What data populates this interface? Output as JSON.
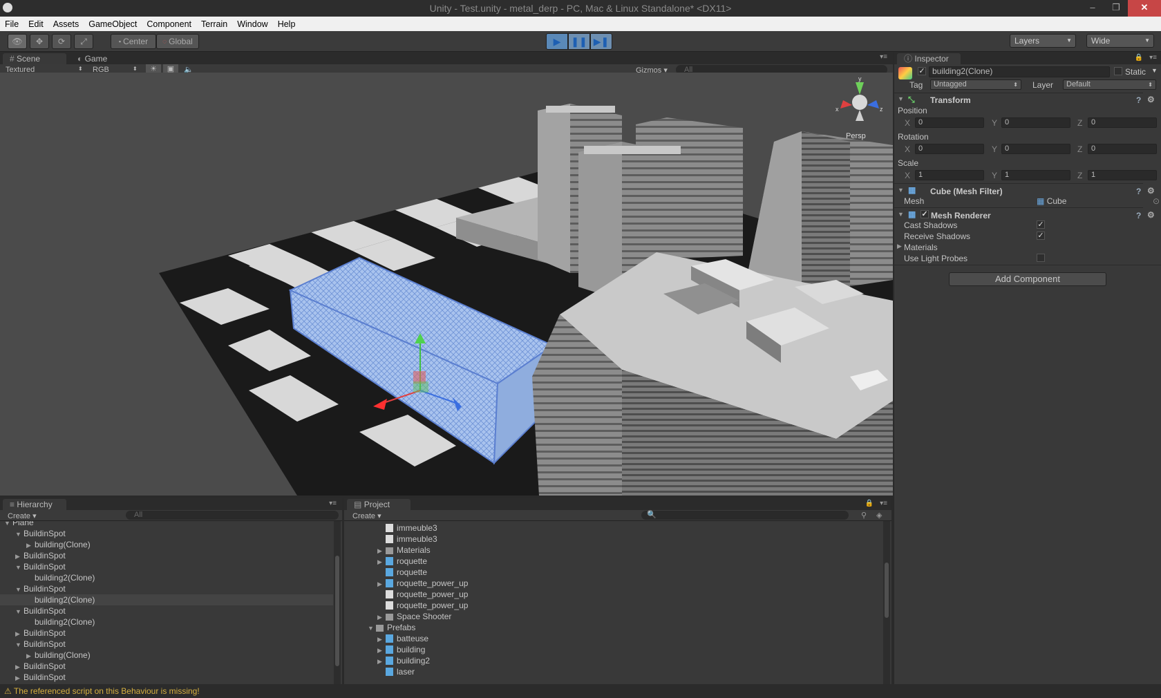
{
  "window": {
    "title": "Unity - Test.unity - metal_derp - PC, Mac & Linux Standalone* <DX11>"
  },
  "menu": [
    "File",
    "Edit",
    "Assets",
    "GameObject",
    "Component",
    "Terrain",
    "Window",
    "Help"
  ],
  "toolbar": {
    "center": "Center",
    "global": "Global",
    "layers": "Layers",
    "layout": "Wide"
  },
  "scene": {
    "tab_scene": "Scene",
    "tab_game": "Game",
    "render_mode": "Textured",
    "color_mode": "RGB",
    "gizmos": "Gizmos",
    "search_placeholder": "All",
    "persp": "Persp"
  },
  "hierarchy": {
    "tab": "Hierarchy",
    "create": "Create",
    "search_placeholder": "All",
    "rows": [
      {
        "label": "Plane",
        "tri": "▼",
        "indent": 0
      },
      {
        "label": "BuildinSpot",
        "tri": "▼",
        "indent": 1
      },
      {
        "label": "building(Clone)",
        "tri": "▶",
        "indent": 2
      },
      {
        "label": "BuildinSpot",
        "tri": "▶",
        "indent": 1
      },
      {
        "label": "BuildinSpot",
        "tri": "▼",
        "indent": 1
      },
      {
        "label": "building2(Clone)",
        "tri": "",
        "indent": 2
      },
      {
        "label": "BuildinSpot",
        "tri": "▼",
        "indent": 1
      },
      {
        "label": "building2(Clone)",
        "tri": "",
        "indent": 2,
        "selected": true
      },
      {
        "label": "BuildinSpot",
        "tri": "▼",
        "indent": 1
      },
      {
        "label": "building2(Clone)",
        "tri": "",
        "indent": 2
      },
      {
        "label": "BuildinSpot",
        "tri": "▶",
        "indent": 1
      },
      {
        "label": "BuildinSpot",
        "tri": "▼",
        "indent": 1
      },
      {
        "label": "building(Clone)",
        "tri": "▶",
        "indent": 2
      },
      {
        "label": "BuildinSpot",
        "tri": "▶",
        "indent": 1
      },
      {
        "label": "BuildinSpot",
        "tri": "▶",
        "indent": 1
      }
    ]
  },
  "project": {
    "tab": "Project",
    "create": "Create",
    "rows": [
      {
        "label": "immeuble3",
        "icon": "doc",
        "tri": "",
        "indent": 2
      },
      {
        "label": "immeuble3",
        "icon": "doc",
        "tri": "",
        "indent": 2
      },
      {
        "label": "Materials",
        "icon": "folder",
        "tri": "▶",
        "indent": 2
      },
      {
        "label": "roquette",
        "icon": "cube",
        "tri": "▶",
        "indent": 2
      },
      {
        "label": "roquette",
        "icon": "cube",
        "tri": "",
        "indent": 2
      },
      {
        "label": "roquette_power_up",
        "icon": "cube",
        "tri": "▶",
        "indent": 2
      },
      {
        "label": "roquette_power_up",
        "icon": "doc",
        "tri": "",
        "indent": 2
      },
      {
        "label": "roquette_power_up",
        "icon": "doc",
        "tri": "",
        "indent": 2
      },
      {
        "label": "Space Shooter",
        "icon": "folder",
        "tri": "▶",
        "indent": 2
      },
      {
        "label": "Prefabs",
        "icon": "folder",
        "tri": "▼",
        "indent": 1
      },
      {
        "label": "batteuse",
        "icon": "cube",
        "tri": "▶",
        "indent": 2
      },
      {
        "label": "building",
        "icon": "cube",
        "tri": "▶",
        "indent": 2
      },
      {
        "label": "building2",
        "icon": "cube",
        "tri": "▶",
        "indent": 2
      },
      {
        "label": "laser",
        "icon": "cube",
        "tri": "",
        "indent": 2
      }
    ]
  },
  "inspector": {
    "tab": "Inspector",
    "object_name": "building2(Clone)",
    "static_label": "Static",
    "tag_label": "Tag",
    "tag_value": "Untagged",
    "layer_label": "Layer",
    "layer_value": "Default",
    "transform": {
      "title": "Transform",
      "position_label": "Position",
      "rotation_label": "Rotation",
      "scale_label": "Scale",
      "position": [
        "0",
        "0",
        "0"
      ],
      "rotation": [
        "0",
        "0",
        "0"
      ],
      "scale": [
        "1",
        "1",
        "1"
      ]
    },
    "mesh_filter": {
      "title": "Cube (Mesh Filter)",
      "mesh_label": "Mesh",
      "mesh_value": "Cube"
    },
    "mesh_renderer": {
      "title": "Mesh Renderer",
      "cast_shadows": "Cast Shadows",
      "receive_shadows": "Receive Shadows",
      "materials": "Materials",
      "light_probes": "Use Light Probes"
    },
    "add_component": "Add Component"
  },
  "status": {
    "message": "The referenced script on this Behaviour is missing!"
  }
}
